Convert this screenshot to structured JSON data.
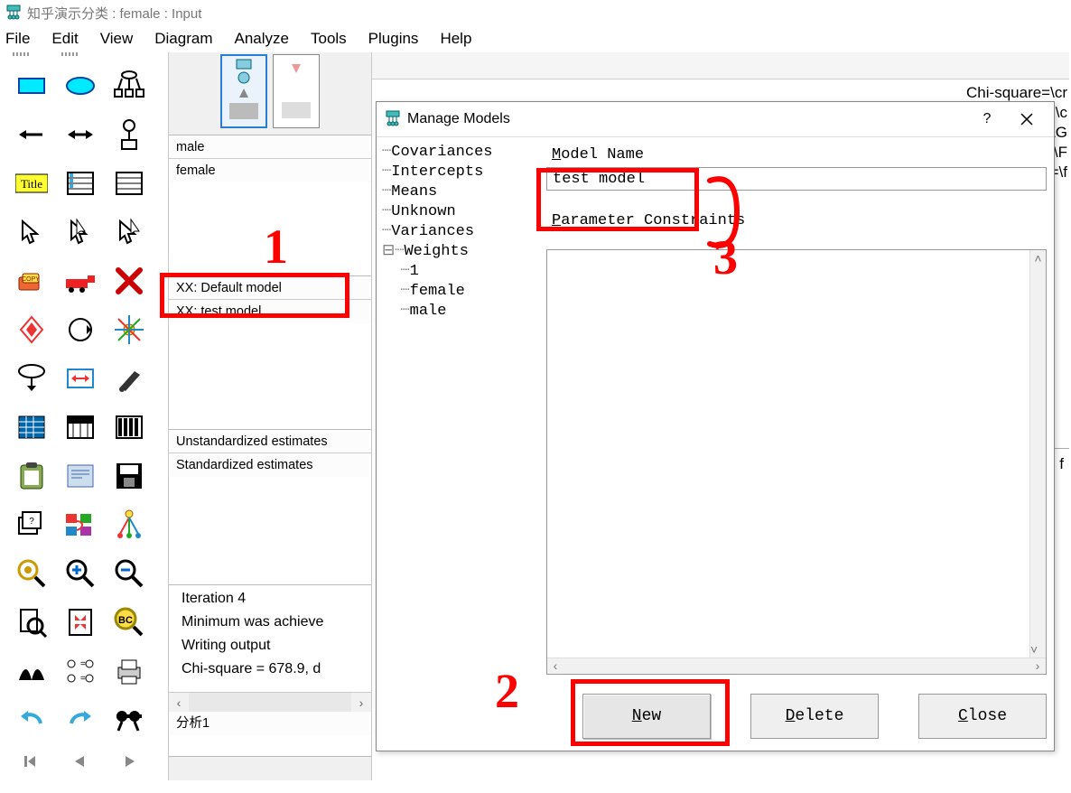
{
  "window": {
    "title": "知乎演示分类 : female : Input"
  },
  "menubar": [
    "File",
    "Edit",
    "View",
    "Diagram",
    "Analyze",
    "Tools",
    "Plugins",
    "Help"
  ],
  "groups": {
    "items": [
      "male",
      "female"
    ]
  },
  "models": {
    "items": [
      "XX: Default model",
      "XX: test model"
    ]
  },
  "estimates": {
    "items": [
      "Unstandardized estimates",
      "Standardized estimates"
    ]
  },
  "log": {
    "lines": [
      "Iteration 4",
      "Minimum was achieve",
      "Writing output",
      "Chi-square = 678.9, d"
    ]
  },
  "analyses": {
    "items": [
      "分析1"
    ]
  },
  "stats_overlay": [
    "Chi-square=\\cr",
    "Chi/DF=\\c",
    "AG",
    "=\\F",
    "=\\f",
    "f"
  ],
  "dialog": {
    "title": "Manage Models",
    "help_label": "?",
    "tree": {
      "items": [
        "Covariances",
        "Intercepts",
        "Means",
        "Unknown",
        "Variances",
        "Weights"
      ],
      "weights_children": [
        "1",
        "female",
        "male"
      ]
    },
    "model_name_label_u": "M",
    "model_name_label_rest": "odel Name",
    "model_name_value": "test model",
    "constraints_label_u": "P",
    "constraints_label_rest": "arameter Constraints",
    "buttons": {
      "new_u": "N",
      "new_rest": "ew",
      "delete_u": "D",
      "delete_rest": "elete",
      "close_u": "C",
      "close_rest": "lose"
    }
  },
  "annotations": {
    "n1": "1",
    "n2": "2",
    "n3": "3"
  }
}
